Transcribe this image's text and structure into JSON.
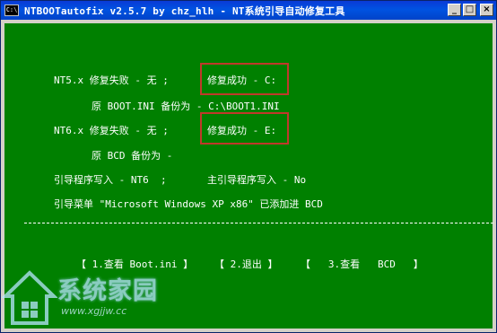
{
  "window": {
    "title": "NTBOOTautofix v2.5.7 by chz_hlh - NT系统引导自动修复工具",
    "icon_glyph": "C:\\",
    "controls": {
      "minimize": "_",
      "maximize": "□",
      "close": "×"
    }
  },
  "console": {
    "nt5_label": "NT5.x 修复失败 - 无 ;",
    "nt5_result": "修复成功 - C:",
    "nt5_backup": "原 BOOT.INI 备份为 - C:\\BOOT1.INI",
    "nt6_label": "NT6.x 修复失败 - 无 ;",
    "nt6_result": "修复成功 - E:",
    "nt6_backup": "原 BCD 备份为 -",
    "boot_write": "引导程序写入 - NT6  ;",
    "mbr_write": "主引导程序写入 - No",
    "menu_added": "引导菜单 \"Microsoft Windows XP x86\" 已添加进 BCD",
    "divider": "------------------------------------------------------------------------"
  },
  "menu": {
    "view_boot_ini": "【 1.查看 Boot.ini 】",
    "exit": "【 2.退出 】",
    "view_bcd": "【   3.查看   BCD   】"
  },
  "watermark": {
    "text": "系统家园",
    "url": "www.xgjjw.cc"
  },
  "colors": {
    "console_bg": "#008000",
    "highlight_border": "#c0392b",
    "titlebar": "#0053e1"
  }
}
